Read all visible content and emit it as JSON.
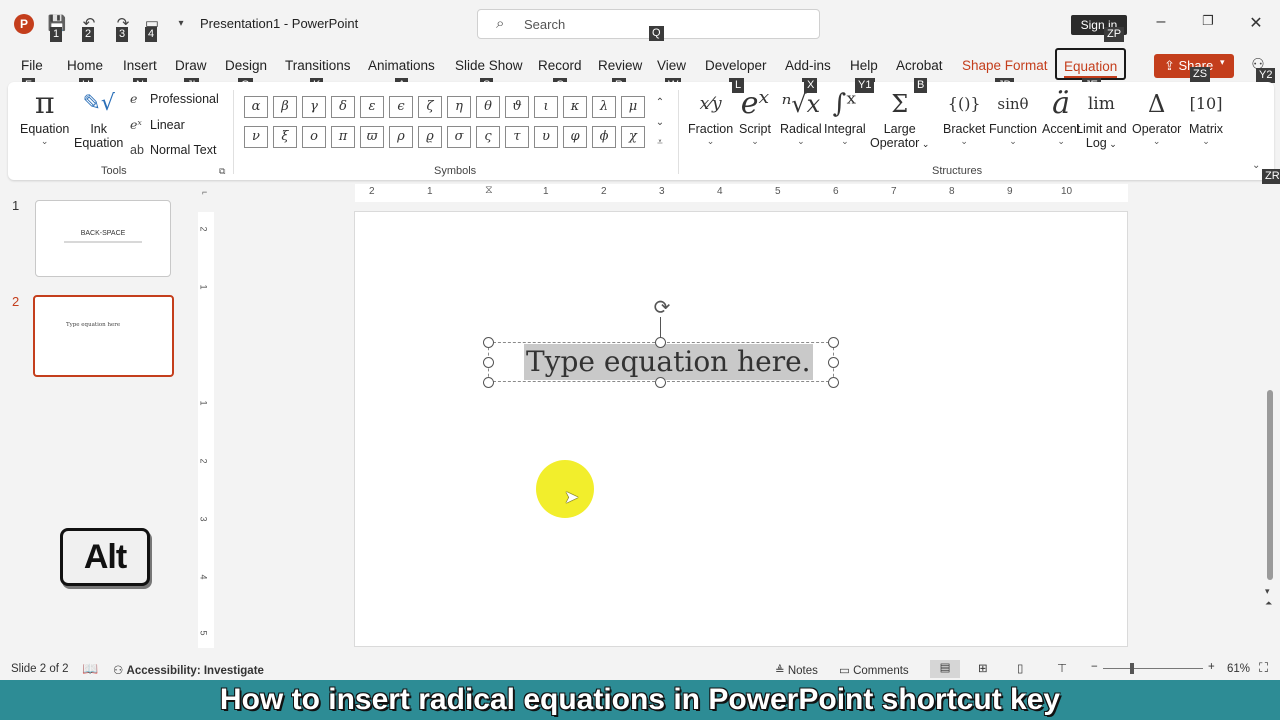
{
  "titlebar": {
    "app_logo": "P",
    "document_title": "Presentation1  -  PowerPoint",
    "search_placeholder": "Search",
    "sign_in": "Sign in",
    "qat_keytips": [
      "1",
      "2",
      "3",
      "4"
    ],
    "search_keytip": "Q",
    "signin_keytip": "ZP"
  },
  "tabs": [
    {
      "label": "File",
      "keytip": "F"
    },
    {
      "label": "Home",
      "keytip": "H"
    },
    {
      "label": "Insert",
      "keytip": "N"
    },
    {
      "label": "Draw",
      "keytip": "JI"
    },
    {
      "label": "Design",
      "keytip": "G"
    },
    {
      "label": "Transitions",
      "keytip": "K"
    },
    {
      "label": "Animations",
      "keytip": "A"
    },
    {
      "label": "Slide Show",
      "keytip": "S"
    },
    {
      "label": "Record",
      "keytip": "C"
    },
    {
      "label": "Review",
      "keytip": "R"
    },
    {
      "label": "View",
      "keytip": "W"
    },
    {
      "label": "Developer",
      "keytip": "L"
    },
    {
      "label": "Add-ins",
      "keytip": "X"
    },
    {
      "label": "Help",
      "keytip": "Y1"
    },
    {
      "label": "Acrobat",
      "keytip": "B"
    },
    {
      "label": "Shape Format",
      "keytip": "JD"
    },
    {
      "label": "Equation",
      "keytip": "JE"
    }
  ],
  "share": {
    "label": "Share",
    "keytip": "ZS",
    "extra_keytip": "Y2"
  },
  "tools": {
    "equation_label": "Equation",
    "ink_label_1": "Ink",
    "ink_label_2": "Equation",
    "professional": "Professional",
    "linear": "Linear",
    "normal_text": "Normal Text",
    "group_label": "Tools"
  },
  "symbols": {
    "row1": [
      "α",
      "β",
      "γ",
      "δ",
      "ε",
      "ϵ",
      "ζ",
      "η",
      "θ",
      "ϑ",
      "ι",
      "κ",
      "λ",
      "μ"
    ],
    "row2": [
      "ν",
      "ξ",
      "ο",
      "π",
      "ϖ",
      "ρ",
      "ϱ",
      "σ",
      "ς",
      "τ",
      "υ",
      "φ",
      "ϕ",
      "χ"
    ],
    "group_label": "Symbols"
  },
  "structures": {
    "items": [
      {
        "label": "Fraction",
        "glyph": "x/y"
      },
      {
        "label": "Script",
        "glyph": "eˣ"
      },
      {
        "label": "Radical",
        "glyph": "ⁿ√x"
      },
      {
        "label": "Integral",
        "glyph": "∫"
      },
      {
        "label": "Large",
        "label2": "Operator",
        "glyph": "Σ"
      },
      {
        "label": "Bracket",
        "glyph": "{()}"
      },
      {
        "label": "Function",
        "glyph": "sinθ"
      },
      {
        "label": "Accent",
        "glyph": "ä"
      },
      {
        "label": "Limit and",
        "label2": "Log",
        "glyph": "lim"
      },
      {
        "label": "Operator",
        "glyph": "Δ"
      },
      {
        "label": "Matrix",
        "glyph": "[10]"
      }
    ],
    "group_label": "Structures",
    "collapse_keytip": "ZR"
  },
  "slides": [
    {
      "number": "1",
      "title": "BACK-SPACE"
    },
    {
      "number": "2",
      "title": "Type equation here"
    }
  ],
  "ruler": {
    "h_ticks": [
      "2",
      "1",
      "1",
      "2",
      "3",
      "4",
      "5",
      "6",
      "7",
      "8",
      "9",
      "10"
    ],
    "v_ticks": [
      "2",
      "1",
      "1",
      "2",
      "3",
      "4",
      "5"
    ]
  },
  "canvas": {
    "equation_placeholder": "Type equation here."
  },
  "overlay": {
    "alt_key": "Alt"
  },
  "statusbar": {
    "slide_count": "Slide 2 of 2",
    "accessibility": "Accessibility: Investigate",
    "notes": "Notes",
    "comments": "Comments",
    "zoom": "61%"
  },
  "caption": "How to insert radical equations in PowerPoint shortcut key",
  "colors": {
    "accent": "#c43e1c",
    "caption_bg": "#2d8c95",
    "highlight": "#f2ee2c"
  }
}
